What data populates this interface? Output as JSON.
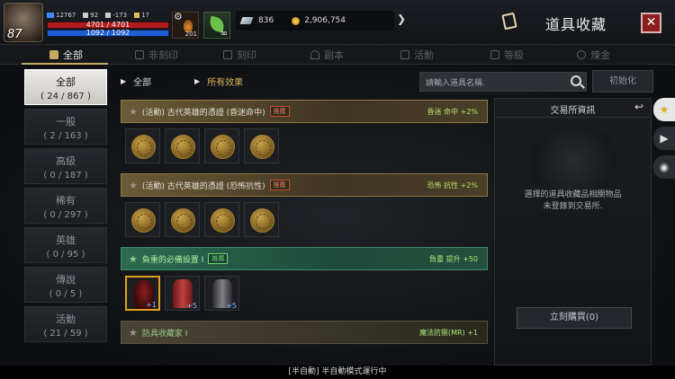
{
  "player": {
    "level": "87",
    "stat_a": "12767",
    "stat_b": "92",
    "stat_c": "-173",
    "stat_d": "17",
    "hp": "4701 / 4701",
    "mp": "1092 / 1092"
  },
  "buffs": {
    "potion_count": "201",
    "leaf_symbol": "∞"
  },
  "currency": {
    "gems": "836",
    "gold": "2,906,754"
  },
  "header": {
    "title": "道具收藏",
    "close": "✕"
  },
  "tabs": [
    {
      "label": "全部",
      "active": true
    },
    {
      "label": "非刻印"
    },
    {
      "label": "刻印"
    },
    {
      "label": "副本"
    },
    {
      "label": "活動"
    },
    {
      "label": "等級"
    },
    {
      "label": "煉金"
    }
  ],
  "sidebar": [
    {
      "label": "全部",
      "count": "( 24 / 867 )",
      "active": true
    },
    {
      "label": "一般",
      "count": "( 2 / 163 )"
    },
    {
      "label": "高級",
      "count": "( 0 / 187 )"
    },
    {
      "label": "稀有",
      "count": "( 0 / 297 )"
    },
    {
      "label": "英雄",
      "count": "( 0 / 95 )"
    },
    {
      "label": "傳說",
      "count": "( 0 / 5 )"
    },
    {
      "label": "活動",
      "count": "( 21 / 59 )"
    }
  ],
  "filters": {
    "category": "全部",
    "effect": "所有效果",
    "search_placeholder": "請輸入道具名稱.",
    "reset": "初始化"
  },
  "sets": [
    {
      "name": "(活動) 古代英雄的憑證 (昏迷命中)",
      "tag": "推薦",
      "effect": "昏迷 命中 +2%",
      "style": "gold"
    },
    {
      "name": "(活動) 古代英雄的憑證 (恐怖抗性)",
      "tag": "推薦",
      "effect": "恐怖 抗性 +2%",
      "style": "gold"
    },
    {
      "name": "負重的必備設置 I",
      "tag": "推薦",
      "effect": "負重 提升 +50",
      "style": "green"
    },
    {
      "name": "防具收藏家 I",
      "effect": "魔法防禦(MR) +1",
      "style": "dim"
    }
  ],
  "item_enchant": [
    "+1",
    "+5",
    "+5"
  ],
  "exchange": {
    "title": "交易所資訊",
    "back": "↩",
    "message_line1": "選擇的道具收藏品相關物品",
    "message_line2": "未登錄到交易所.",
    "buy": "立刻購買(0)"
  },
  "side_tabs": [
    "★",
    "▶",
    "◉"
  ],
  "status": {
    "text": "[半自動] 半自動模式運行中"
  }
}
